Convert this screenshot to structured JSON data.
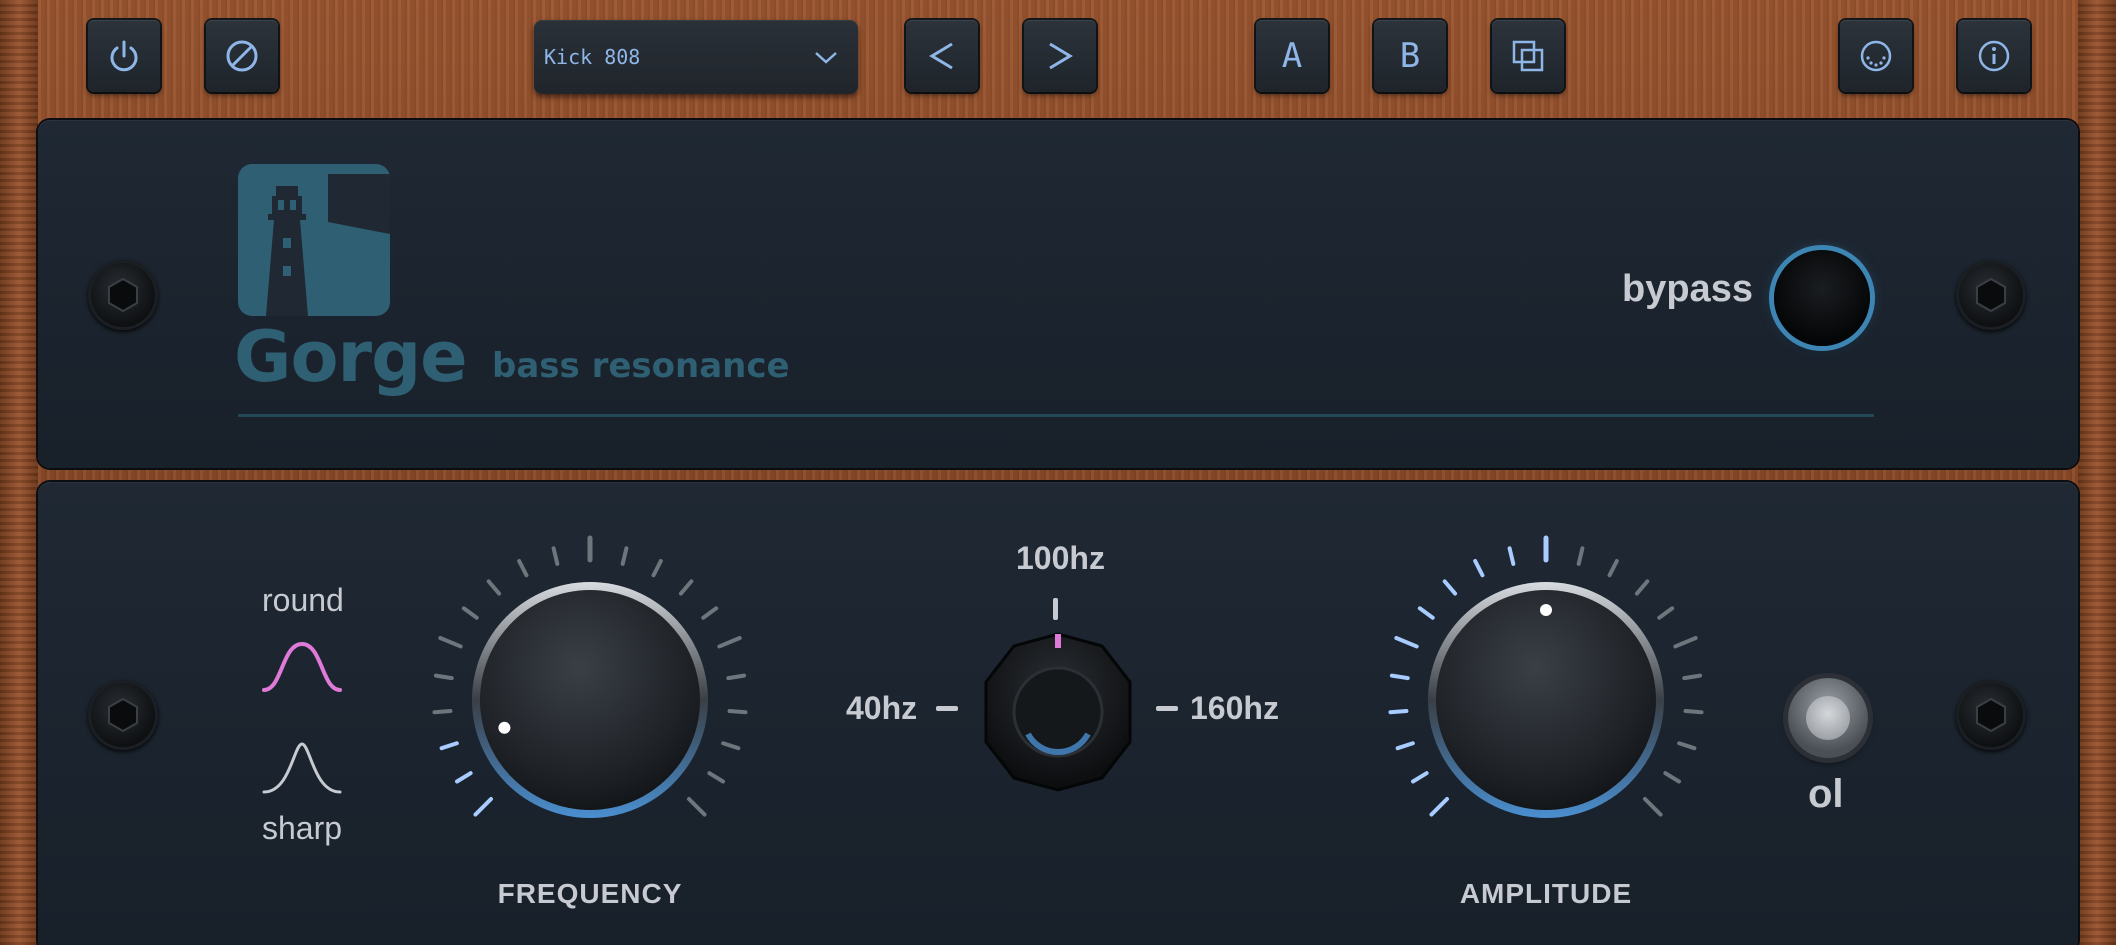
{
  "toolbar": {
    "preset_name": "Kick 808",
    "ab_a": "A",
    "ab_b": "B"
  },
  "brand": {
    "name": "Gorge",
    "tagline": "bass resonance"
  },
  "bypass": {
    "label": "bypass"
  },
  "filter_shape": {
    "round_label": "round",
    "sharp_label": "sharp",
    "selected": "round"
  },
  "frequency": {
    "label": "FREQUENCY",
    "value": 0.1
  },
  "range": {
    "low_label": "40hz",
    "mid_label": "100hz",
    "high_label": "160hz",
    "selected": "100hz"
  },
  "amplitude": {
    "label": "AMPLITUDE",
    "value": 0.5
  },
  "overload": {
    "label": "ol"
  },
  "colors": {
    "accent_blue": "#8fb6e8",
    "accent_pink": "#e07ad8",
    "logo": "#2f5f72",
    "bypass_ring": "#3d86b3"
  }
}
